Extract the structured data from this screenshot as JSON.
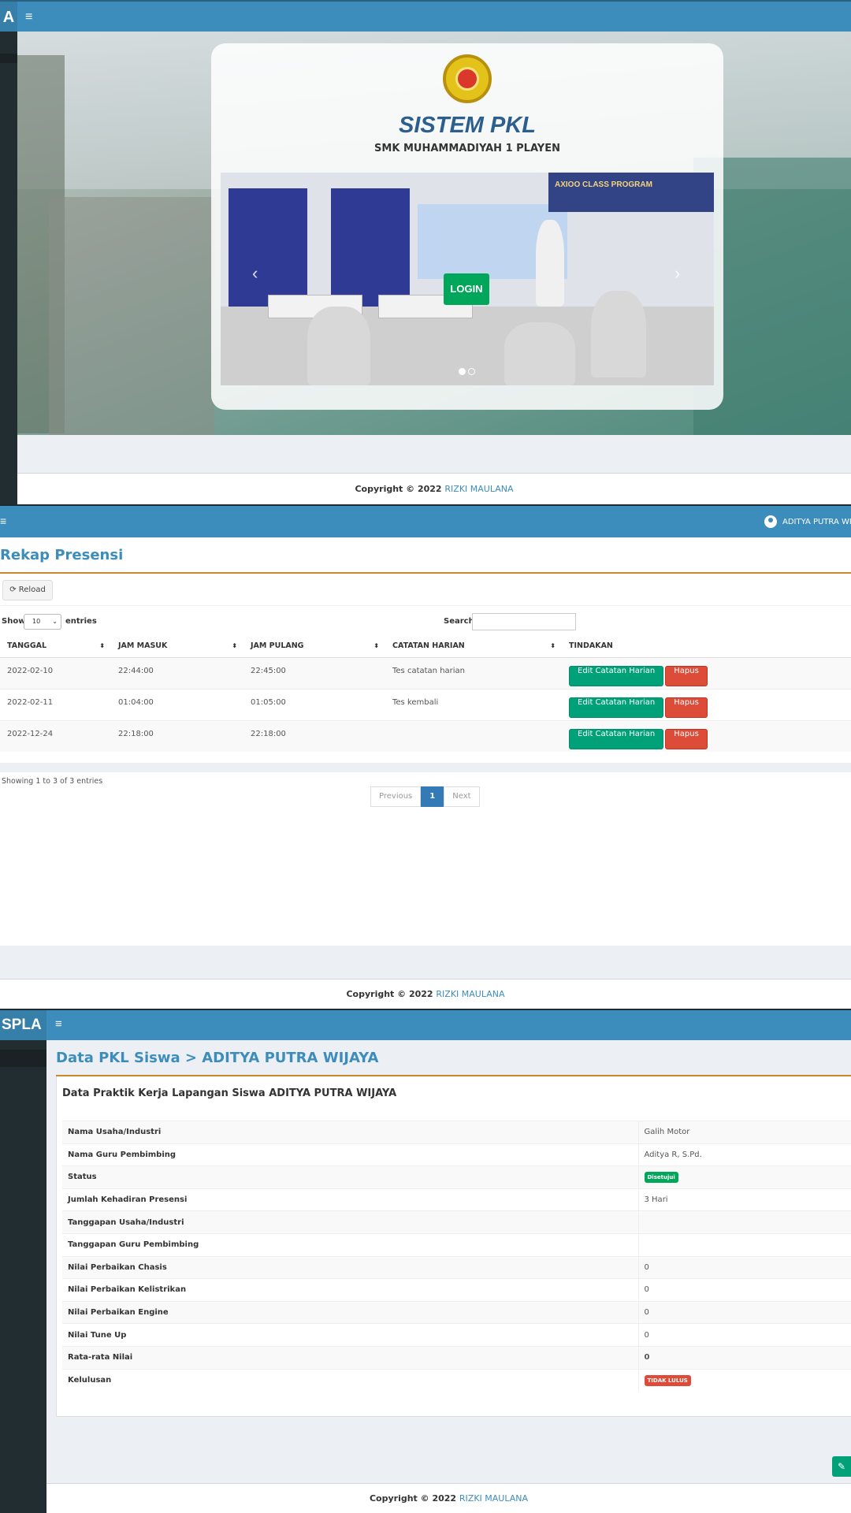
{
  "panel1": {
    "brand": "A",
    "menu_icon": "hamburger-icon",
    "title": "SISTEM PKL",
    "subtitle": "SMK MUHAMMADIYAH 1 PLAYEN",
    "login_label": "LOGIN",
    "banner_text": "AXIOO CLASS PROGRAM",
    "footer": {
      "prefix": "Copyright © 2022 ",
      "link": "RIZKI MAULANA"
    }
  },
  "panel2": {
    "menu_icon": "hamburger-icon",
    "user_name": "ADITYA PUTRA WIJ",
    "page_title": "Rekap Presensi",
    "reload_label": "Reload",
    "show_label": "Show",
    "page_length": "10",
    "entries_label": "entries",
    "search_label": "Search:",
    "columns": [
      "TANGGAL",
      "JAM MASUK",
      "JAM PULANG",
      "CATATAN HARIAN",
      "TINDAKAN"
    ],
    "rows": [
      {
        "tanggal": "2022-02-10",
        "masuk": "22:44:00",
        "pulang": "22:45:00",
        "catatan": "Tes catatan harian"
      },
      {
        "tanggal": "2022-02-11",
        "masuk": "01:04:00",
        "pulang": "01:05:00",
        "catatan": "Tes kembali"
      },
      {
        "tanggal": "2022-12-24",
        "masuk": "22:18:00",
        "pulang": "22:18:00",
        "catatan": ""
      }
    ],
    "edit_label": "Edit Catatan Harian",
    "delete_label": "Hapus",
    "info": "Showing 1 to 3 of 3 entries",
    "pager": {
      "prev": "Previous",
      "current": "1",
      "next": "Next"
    },
    "footer": {
      "prefix": "Copyright © 2022 ",
      "link": "RIZKI MAULANA"
    }
  },
  "panel3": {
    "brand": "SPLA",
    "menu_icon": "hamburger-icon",
    "page_title": "Data PKL Siswa > ADITYA PUTRA WIJAYA",
    "box_title": "Data Praktik Kerja Lapangan Siswa ADITYA PUTRA WIJAYA",
    "rows": [
      {
        "key": "Nama Usaha/Industri",
        "value": "Galih Motor"
      },
      {
        "key": "Nama Guru Pembimbing",
        "value": "Aditya R, S.Pd."
      },
      {
        "key": "Status",
        "value": "Disetujui"
      },
      {
        "key": "Jumlah Kehadiran Presensi",
        "value": "3 Hari"
      },
      {
        "key": "Tanggapan Usaha/Industri",
        "value": ""
      },
      {
        "key": "Tanggapan Guru Pembimbing",
        "value": ""
      },
      {
        "key": "Nilai Perbaikan Chasis",
        "value": "0"
      },
      {
        "key": "Nilai Perbaikan Kelistrikan",
        "value": "0"
      },
      {
        "key": "Nilai Perbaikan Engine",
        "value": "0"
      },
      {
        "key": "Nilai Tune Up",
        "value": "0"
      },
      {
        "key": "Rata-rata Nilai",
        "value": "0"
      },
      {
        "key": "Kelulusan",
        "value": "TIDAK LULUS"
      }
    ],
    "edit_icon": "edit-icon",
    "footer": {
      "prefix": "Copyright © 2022 ",
      "link": "RIZKI MAULANA"
    }
  },
  "colors": {
    "primary": "#3c8dbc",
    "sidebar": "#222d32",
    "success": "#00a65a",
    "danger": "#dd4b39",
    "teal": "#00a078",
    "accent_line": "#c9882c"
  }
}
